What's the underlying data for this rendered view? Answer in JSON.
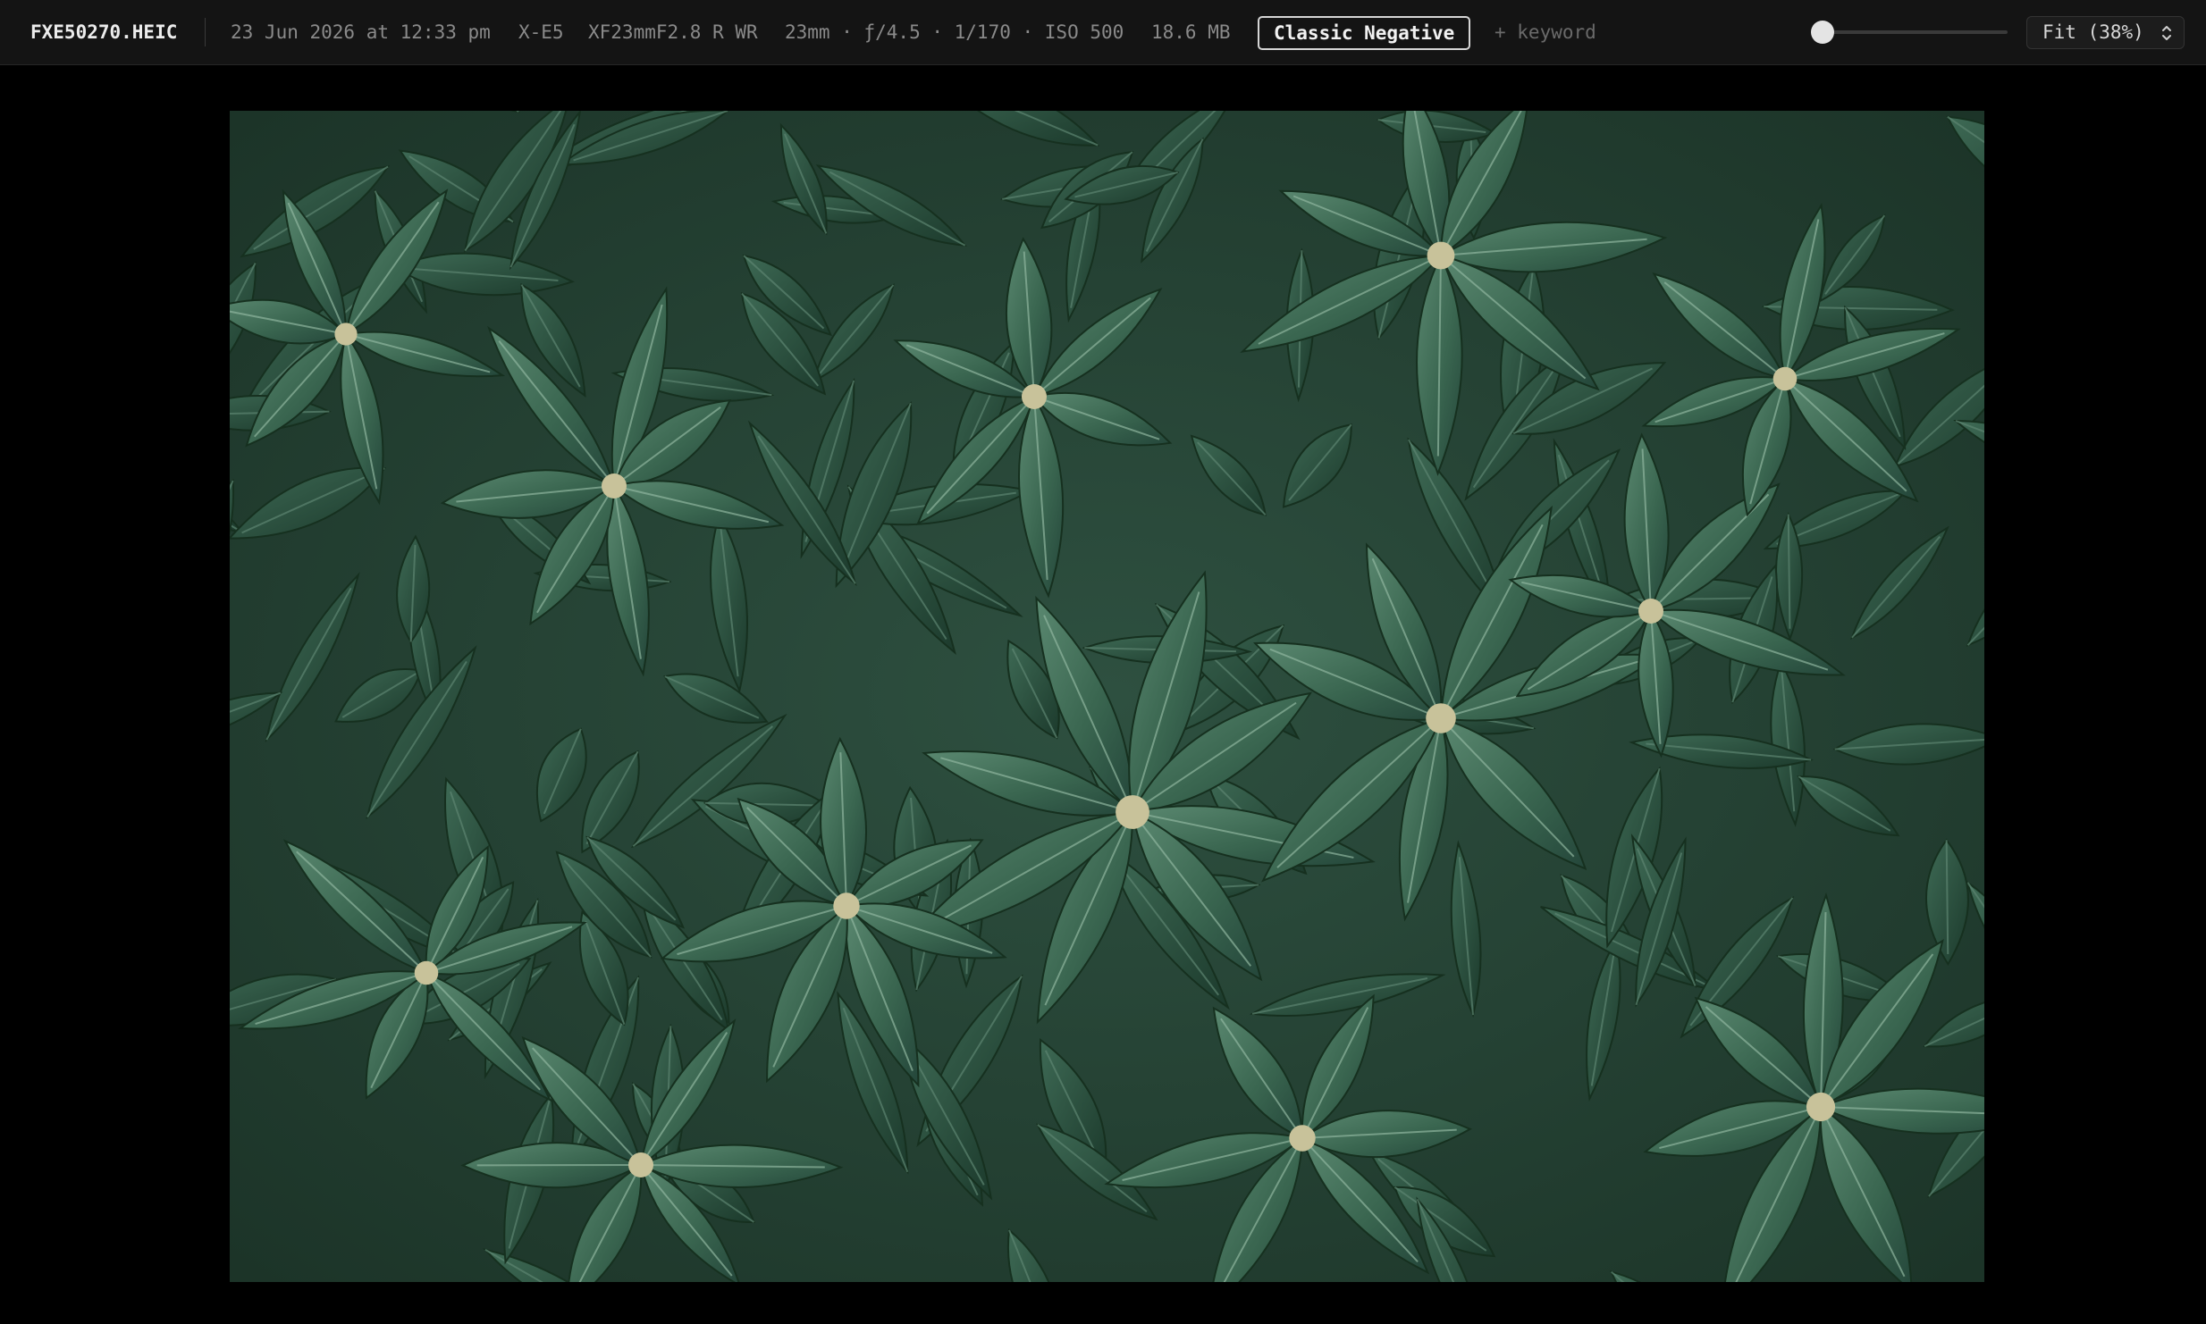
{
  "toolbar": {
    "filename": "FXE50270.HEIC",
    "date": "23 Jun 2026 at 12:33 pm",
    "camera": "X-E5",
    "lens": "XF23mmF2.8 R WR",
    "exposure": "23mm · ƒ/4.5 · 1/170 · ISO 500",
    "file_size": "18.6 MB",
    "film_simulation": "Classic Negative",
    "keyword_placeholder": "+ keyword",
    "zoom_slider_value": 0,
    "zoom_label": "Fit (38%)"
  },
  "icons": {
    "zoom_select": "chevron-up-down-icon"
  },
  "colors": {
    "toolbar_bg": "#141414",
    "viewer_bg": "#000000",
    "badge_border": "#d6d6d6",
    "leaf_dark": "#1f3b2b",
    "leaf_mid": "#3a6650",
    "leaf_light": "#5e8a72"
  }
}
